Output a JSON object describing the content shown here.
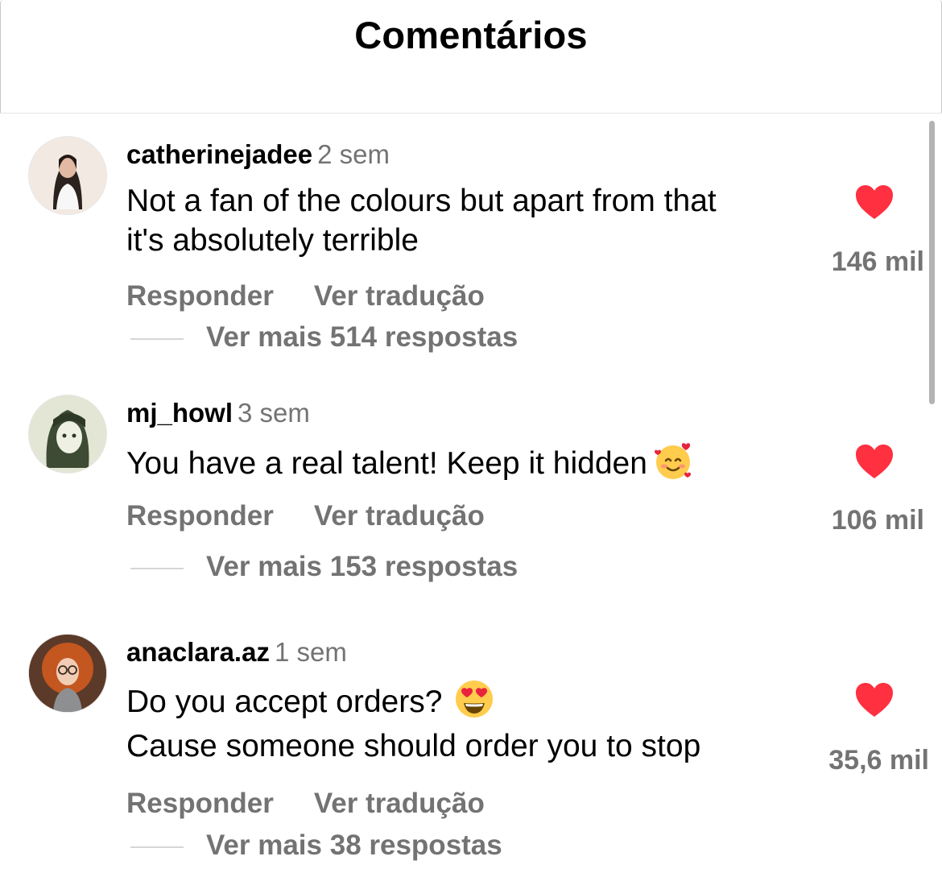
{
  "header": {
    "title": "Comentários"
  },
  "comments": [
    {
      "username": "catherinejadee",
      "time": "2 sem",
      "lines": [
        "Not a fan of the colours but apart from that",
        "it's absolutely terrible"
      ],
      "emoji": "",
      "reply_label": "Responder",
      "translate_label": "Ver tradução",
      "more_replies": "Ver mais 514 respostas",
      "likes": "146 mil",
      "liked": true
    },
    {
      "username": "mj_howl",
      "time": "3 sem",
      "lines": [
        "You have a real talent! Keep it hidden"
      ],
      "emoji": "smiling-face-with-hearts",
      "reply_label": "Responder",
      "translate_label": "Ver tradução",
      "more_replies": "Ver mais 153 respostas",
      "likes": "106 mil",
      "liked": true
    },
    {
      "username": "anaclara.az",
      "time": "1 sem",
      "lines": [
        "Do you accept orders?",
        "Cause someone should order you to stop"
      ],
      "emoji": "heart-eyes",
      "reply_label": "Responder",
      "translate_label": "Ver tradução",
      "more_replies": "Ver mais 38 respostas",
      "likes": "35,6 mil",
      "liked": true
    }
  ],
  "colors": {
    "heart": "#ff3040",
    "secondary_text": "#737373",
    "primary_text": "#000000"
  }
}
